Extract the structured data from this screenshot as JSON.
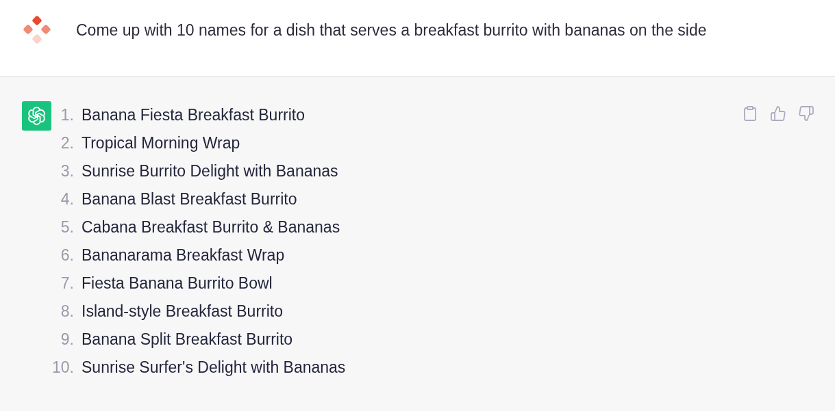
{
  "conversation": [
    {
      "kind": "user",
      "text": "Come up with 10 names for a dish that serves a breakfast burrito with bananas on the side"
    },
    {
      "kind": "assistant",
      "items": [
        {
          "number": "1.",
          "text": "Banana Fiesta Breakfast Burrito"
        },
        {
          "number": "2.",
          "text": "Tropical Morning Wrap"
        },
        {
          "number": "3.",
          "text": "Sunrise Burrito Delight with Bananas"
        },
        {
          "number": "4.",
          "text": "Banana Blast Breakfast Burrito"
        },
        {
          "number": "5.",
          "text": "Cabana Breakfast Burrito & Bananas"
        },
        {
          "number": "6.",
          "text": "Bananarama Breakfast Wrap"
        },
        {
          "number": "7.",
          "text": "Fiesta Banana Burrito Bowl"
        },
        {
          "number": "8.",
          "text": "Island-style Breakfast Burrito"
        },
        {
          "number": "9.",
          "text": "Banana Split Breakfast Burrito"
        },
        {
          "number": "10.",
          "text": "Sunrise Surfer's Delight with Bananas"
        }
      ]
    }
  ]
}
